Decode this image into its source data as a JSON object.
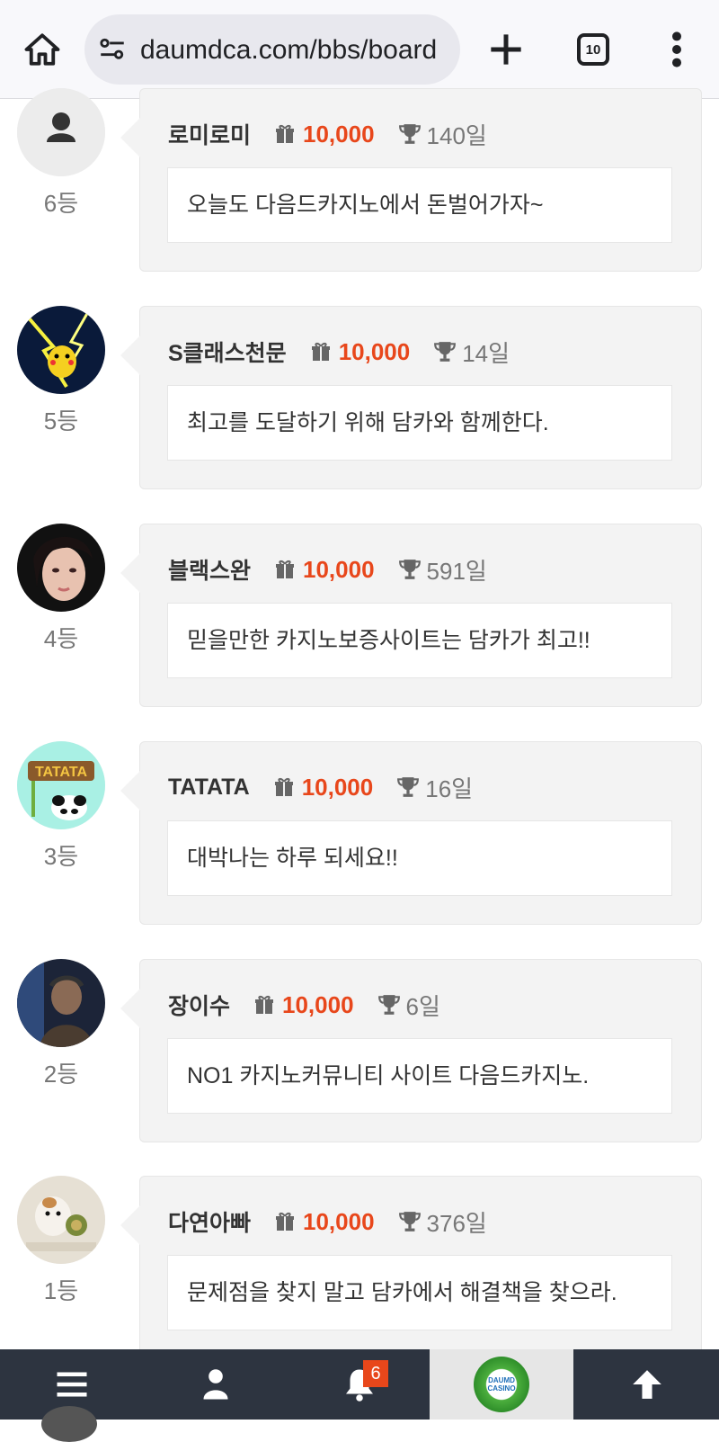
{
  "browser": {
    "url": "daumdca.com/bbs/board",
    "tab_count": "10"
  },
  "comments": [
    {
      "rank": "6등",
      "nickname": "로미로미",
      "points": "10,000",
      "days": "140일",
      "message": "오늘도 다음드카지노에서 돈벌어가자~",
      "avatar": "default-user-icon"
    },
    {
      "rank": "5등",
      "nickname": "S클래스천문",
      "points": "10,000",
      "days": "14일",
      "message": "최고를 도달하기 위해 담카와 함께한다.",
      "avatar": "pikachu-lightning-image"
    },
    {
      "rank": "4등",
      "nickname": "블랙스완",
      "points": "10,000",
      "days": "591일",
      "message": "믿을만한 카지노보증사이트는 담카가 최고!!",
      "avatar": "woman-portrait-image"
    },
    {
      "rank": "3등",
      "nickname": "TATATA",
      "points": "10,000",
      "days": "16일",
      "message": "대박나는 하루 되세요!!",
      "avatar": "tatata-panda-image",
      "avatar_text": "TATATA"
    },
    {
      "rank": "2등",
      "nickname": "장이수",
      "points": "10,000",
      "days": "6일",
      "message": "NO1 카지노커뮤니티 사이트 다음드카지노.",
      "avatar": "man-portrait-image"
    },
    {
      "rank": "1등",
      "nickname": "다연아빠",
      "points": "10,000",
      "days": "376일",
      "message": "문제점을 찾지 말고 담카에서 해결책을 찾으라.",
      "avatar": "hamster-image"
    }
  ],
  "bottom_nav": {
    "notification_count": "6",
    "logo_top": "DAUMD",
    "logo_bottom": "CASINO"
  },
  "colors": {
    "points": "#e8471b",
    "nav_background": "#2d3440",
    "bubble_background": "#f3f3f3"
  }
}
